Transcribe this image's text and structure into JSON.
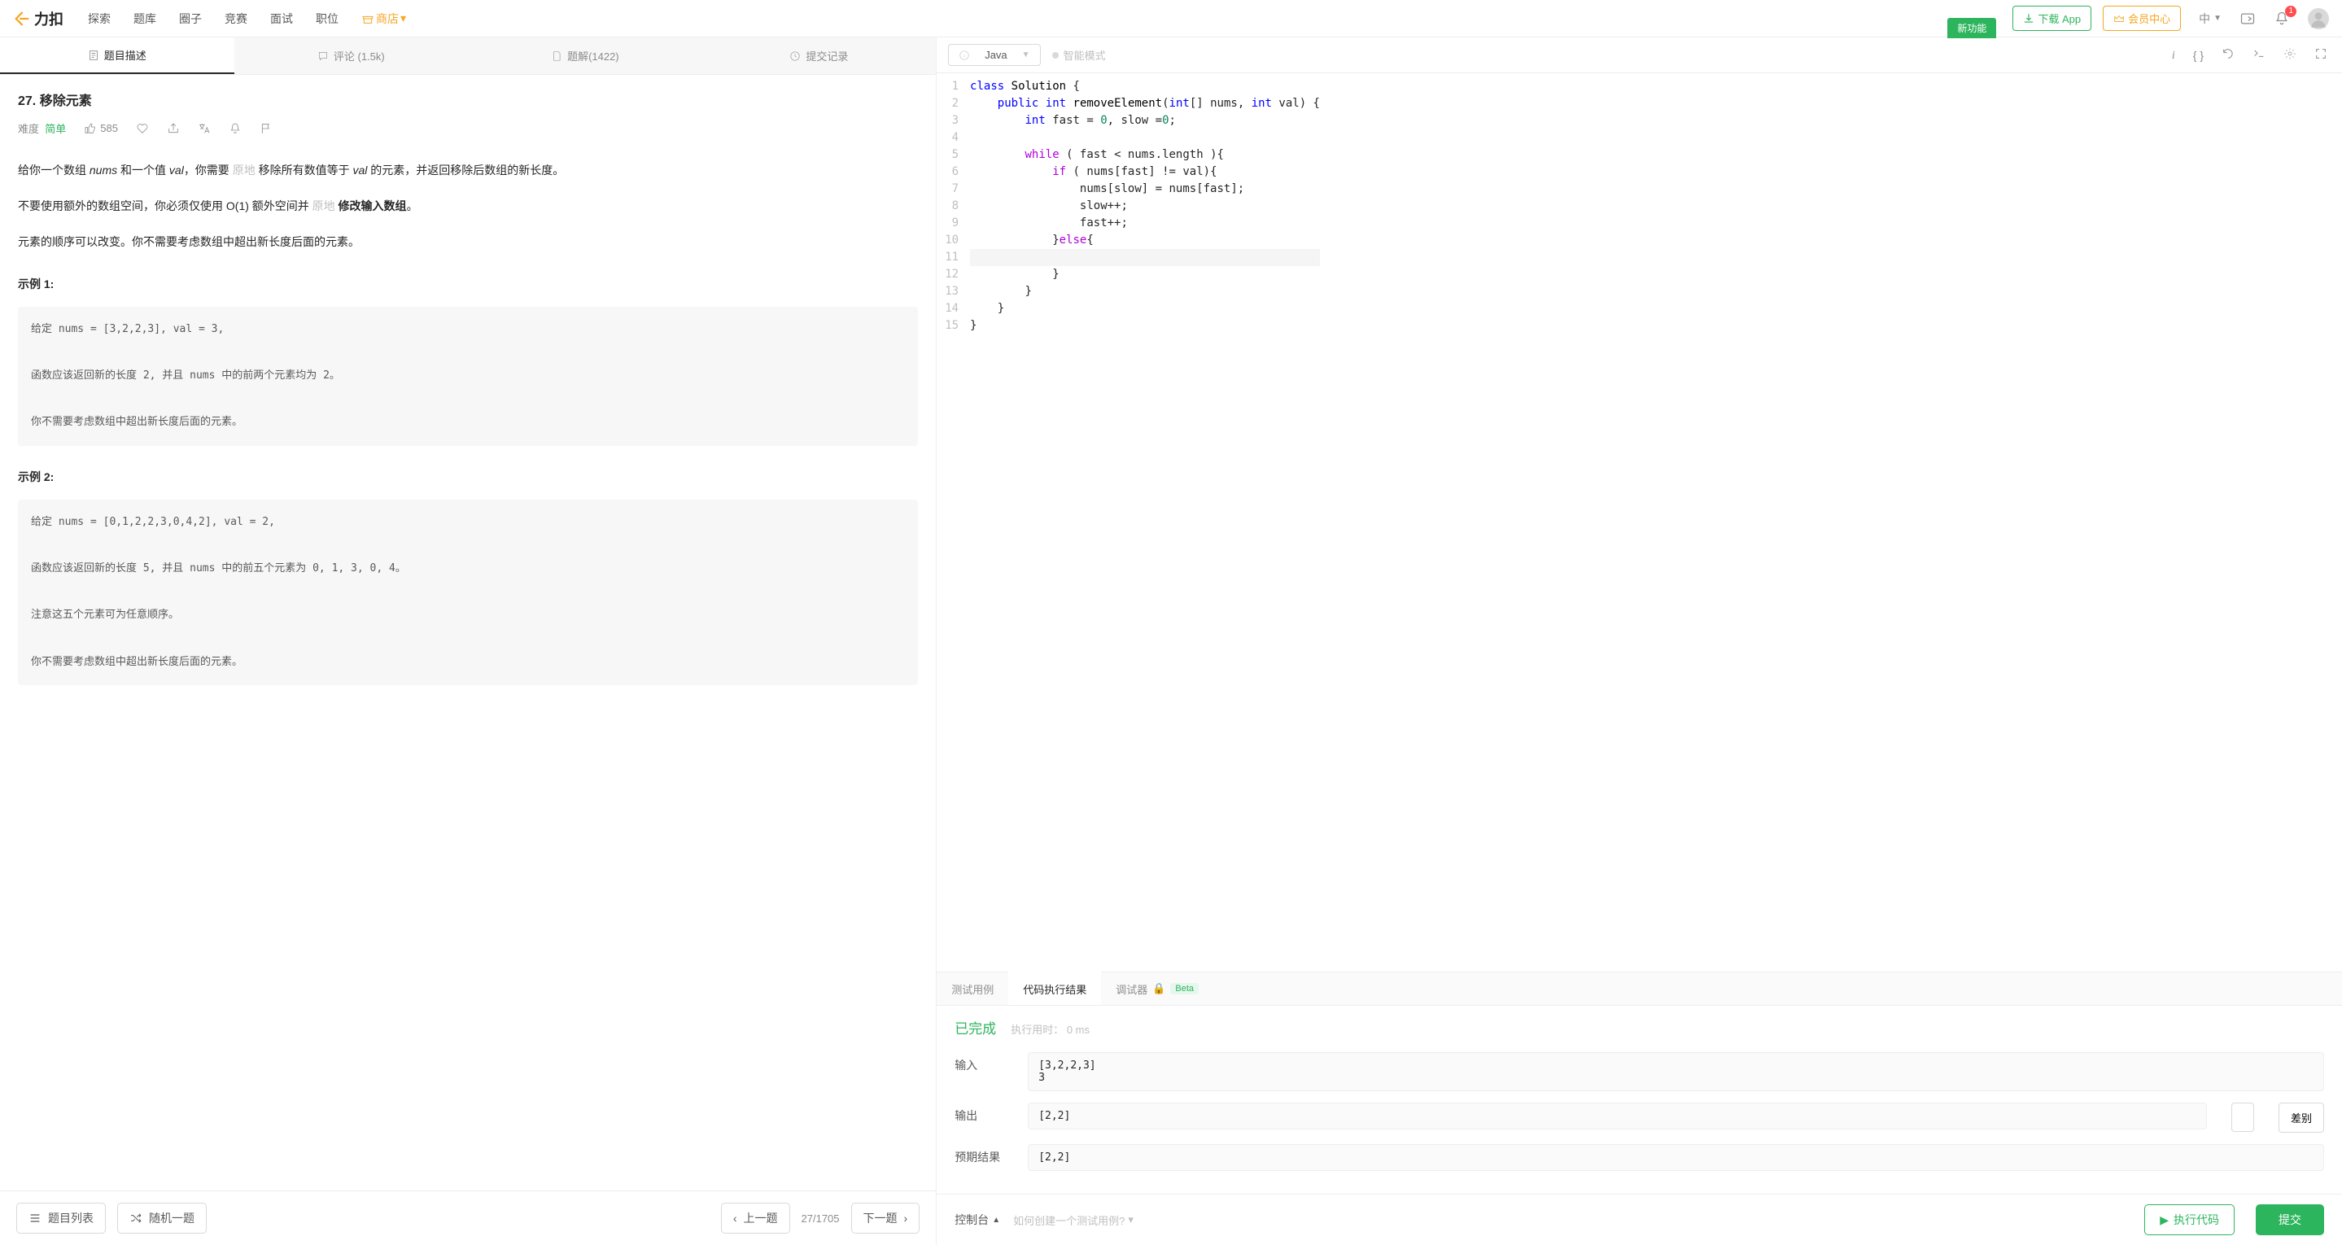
{
  "topbar": {
    "brand": "力扣",
    "nav": [
      "探索",
      "题库",
      "圈子",
      "竞赛",
      "面试",
      "职位"
    ],
    "store": "商店",
    "new_feature": "新功能",
    "download": "下载 App",
    "vip": "会员中心",
    "lang": "中",
    "notif_count": "1"
  },
  "tabs": {
    "description": "题目描述",
    "comments": "评论 (1.5k)",
    "solutions": "题解(1422)",
    "submissions": "提交记录"
  },
  "problem": {
    "title": "27. 移除元素",
    "difficulty_label": "难度",
    "difficulty": "简单",
    "likes": "585",
    "para1_a": "给你一个数组 ",
    "para1_b": " 和一个值 ",
    "para1_c": "，你需要 ",
    "para1_inplace": "原地",
    "para1_d": " 移除所有数值等于 ",
    "para1_e": " 的元素，并返回移除后数组的新长度。",
    "para2_a": "不要使用额外的数组空间，你必须仅使用 O(1) 额外空间并 ",
    "para2_b": " 修改输入数组",
    "para2_c": "。",
    "para3": "元素的顺序可以改变。你不需要考虑数组中超出新长度后面的元素。",
    "nums": "nums",
    "val": "val",
    "example1_label": "示例 1:",
    "example1_l1": "给定 nums = [3,2,2,3], val = 3,",
    "example1_l2": "函数应该返回新的长度 2, 并且 nums 中的前两个元素均为 2。",
    "example1_l3": "你不需要考虑数组中超出新长度后面的元素。",
    "example2_label": "示例 2:",
    "example2_l1": "给定 nums = [0,1,2,2,3,0,4,2], val = 2,",
    "example2_l2": "函数应该返回新的长度 5, 并且 nums 中的前五个元素为 0, 1, 3, 0, 4。",
    "example2_l3": "注意这五个元素可为任意顺序。",
    "example2_l4": "你不需要考虑数组中超出新长度后面的元素。"
  },
  "left_footer": {
    "list": "题目列表",
    "random": "随机一题",
    "prev": "上一题",
    "progress": "27/1705",
    "next": "下一题"
  },
  "editor": {
    "language": "Java",
    "smart_mode": "智能模式",
    "code_lines": [
      {
        "n": 1,
        "html": "<span class='kw1'>class</span> <span class='id'>Solution</span> {"
      },
      {
        "n": 2,
        "html": "    <span class='kw1'>public</span> <span class='kw1'>int</span> <span class='fn'>removeElement</span>(<span class='kw1'>int</span>[] nums, <span class='kw1'>int</span> val) {"
      },
      {
        "n": 3,
        "html": "        <span class='kw1'>int</span> fast = <span class='num'>0</span>, slow =<span class='num'>0</span>;"
      },
      {
        "n": 4,
        "html": ""
      },
      {
        "n": 5,
        "html": "        <span class='kw3'>while</span> ( fast &lt; nums.length ){"
      },
      {
        "n": 6,
        "html": "            <span class='kw3'>if</span> ( nums[fast] != val){"
      },
      {
        "n": 7,
        "html": "                nums[slow] = nums[fast];"
      },
      {
        "n": 8,
        "html": "                slow++;"
      },
      {
        "n": 9,
        "html": "                fast++;"
      },
      {
        "n": 10,
        "html": "            }<span class='kw3'>else</span>{"
      },
      {
        "n": 11,
        "html": "                "
      },
      {
        "n": 12,
        "html": "            }"
      },
      {
        "n": 13,
        "html": "        }"
      },
      {
        "n": 14,
        "html": "    }"
      },
      {
        "n": 15,
        "html": "}"
      }
    ]
  },
  "results": {
    "tab_testcase": "测试用例",
    "tab_result": "代码执行结果",
    "tab_debugger": "调试器",
    "beta": "Beta",
    "status": "已完成",
    "runtime_label": "执行用时：",
    "runtime_value": "0 ms",
    "input_label": "输入",
    "input_value": "[3,2,2,3]\n3",
    "output_label": "输出",
    "output_value": "[2,2]",
    "expected_label": "预期结果",
    "expected_value": "[2,2]",
    "diff": "差别"
  },
  "right_footer": {
    "console": "控制台",
    "howto": "如何创建一个测试用例?",
    "run": "执行代码",
    "submit": "提交"
  }
}
